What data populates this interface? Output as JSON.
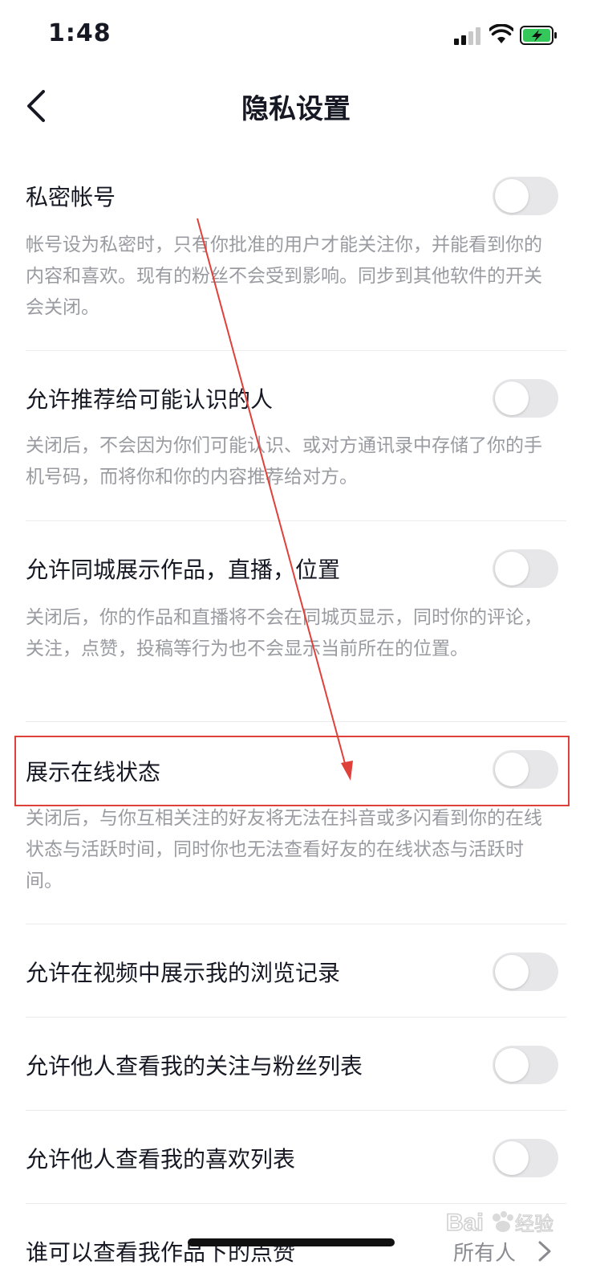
{
  "status_bar": {
    "time": "1:48"
  },
  "nav": {
    "title": "隐私设置"
  },
  "settings": [
    {
      "title": "私密帐号",
      "desc": "帐号设为私密时，只有你批准的用户才能关注你，并能看到你的内容和喜欢。现有的粉丝不会受到影响。同步到其他软件的开关会关闭。",
      "enabled": false
    },
    {
      "title": "允许推荐给可能认识的人",
      "desc": "关闭后，不会因为你们可能认识、或对方通讯录中存储了你的手机号码，而将你和你的内容推荐给对方。",
      "enabled": false
    },
    {
      "title": "允许同城展示作品，直播，位置",
      "desc": "关闭后，你的作品和直播将不会在同城页显示，同时你的评论，关注，点赞，投稿等行为也不会显示当前所在的位置。",
      "enabled": false
    },
    {
      "title": "展示在线状态",
      "desc": "关闭后，与你互相关注的好友将无法在抖音或多闪看到你的在线状态与活跃时间，同时你也无法查看好友的在线状态与活跃时间。",
      "enabled": false
    },
    {
      "title": "允许在视频中展示我的浏览记录",
      "enabled": false
    },
    {
      "title": "允许他人查看我的关注与粉丝列表",
      "enabled": false
    },
    {
      "title": "允许他人查看我的喜欢列表",
      "enabled": false
    },
    {
      "title": "谁可以查看我作品下的点赞",
      "value": "所有人"
    }
  ],
  "annotation": {
    "highlight_color": "#e0403a"
  },
  "watermark": {
    "text": "Baidu 经验"
  }
}
